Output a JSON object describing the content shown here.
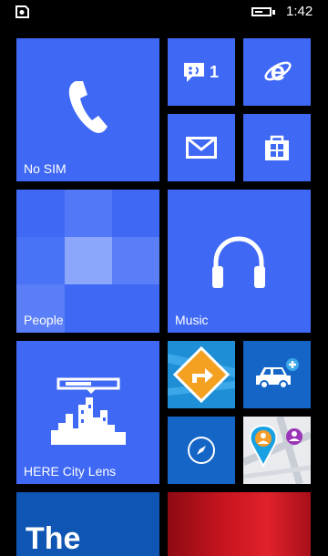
{
  "status_bar": {
    "time": "1:42",
    "battery_level": 0.6
  },
  "tiles": {
    "phone": {
      "label": "No SIM",
      "icon": "phone-icon"
    },
    "messaging": {
      "count": "1",
      "icon": "chat-bubble-icon"
    },
    "internet_explorer": {
      "icon": "internet-explorer-icon"
    },
    "mail": {
      "icon": "mail-icon"
    },
    "store": {
      "icon": "store-icon"
    },
    "people": {
      "label": "People",
      "icon": "people-mosaic"
    },
    "music": {
      "label": "Music",
      "icon": "headphones-icon"
    },
    "city_lens": {
      "label": "HERE City Lens",
      "icon": "city-lens-icon"
    },
    "here_drive": {
      "icon": "drive-arrow-icon"
    },
    "car_app": {
      "icon": "car-add-icon"
    },
    "compass": {
      "icon": "compass-icon"
    },
    "here_maps": {
      "icon": "map-pin-icon"
    },
    "news": {
      "text": "The",
      "color": "#0f55b3"
    },
    "red_tile": {
      "color": "#b4101b"
    }
  },
  "colors": {
    "accent": "#3f68f5",
    "background": "#000000"
  }
}
